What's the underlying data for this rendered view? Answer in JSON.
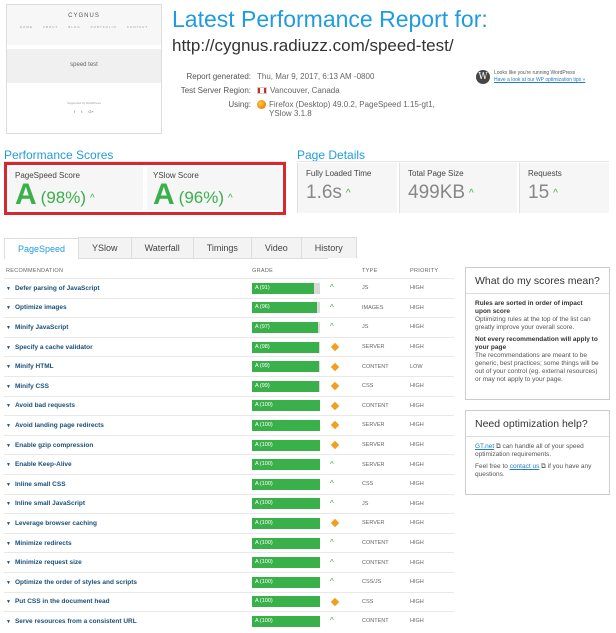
{
  "thumbnail": {
    "site_name": "CYGNUS",
    "nav": [
      "HOME",
      "ABOUT",
      "BLOG",
      "PORTFOLIO",
      "CONTACT"
    ],
    "hero_text": "speed test",
    "footer_text": "Supported by WordPress",
    "social": [
      "f",
      "t",
      "G+"
    ]
  },
  "header": {
    "title": "Latest Performance Report for:",
    "url": "http://cygnus.radiuzz.com/speed-test/"
  },
  "meta": {
    "generated_label": "Report generated:",
    "generated_value": "Thu, Mar 9, 2017, 6:13 AM -0800",
    "region_label": "Test Server Region:",
    "region_value": "Vancouver, Canada",
    "using_label": "Using:",
    "using_value_1": "Firefox (Desktop) 49.0.2, PageSpeed 1.15-gt1,",
    "using_value_2": "YSlow 3.1.8"
  },
  "wordpress": {
    "line1": "Looks like you're running WordPress",
    "link": "Have a look at our WP optimization tips »"
  },
  "performance": {
    "title": "Performance Scores",
    "scores": [
      {
        "label": "PageSpeed Score",
        "grade": "A",
        "value": "(98%)"
      },
      {
        "label": "YSlow Score",
        "grade": "A",
        "value": "(96%)"
      }
    ]
  },
  "page_details": {
    "title": "Page Details",
    "items": [
      {
        "label": "Fully Loaded Time",
        "value": "1.6s"
      },
      {
        "label": "Total Page Size",
        "value": "499KB"
      },
      {
        "label": "Requests",
        "value": "15"
      }
    ]
  },
  "tabs": [
    "PageSpeed",
    "YSlow",
    "Waterfall",
    "Timings",
    "Video",
    "History"
  ],
  "table": {
    "headers": [
      "RECOMMENDATION",
      "GRADE",
      "TYPE",
      "PRIORITY"
    ],
    "rows": [
      {
        "rec": "Defer parsing of JavaScript",
        "grade": "A (91)",
        "pct": 91,
        "icon": "up",
        "type": "JS",
        "priority": "HIGH"
      },
      {
        "rec": "Optimize images",
        "grade": "A (96)",
        "pct": 96,
        "icon": "up",
        "type": "IMAGES",
        "priority": "HIGH"
      },
      {
        "rec": "Minify JavaScript",
        "grade": "A (97)",
        "pct": 97,
        "icon": "up",
        "type": "JS",
        "priority": "HIGH"
      },
      {
        "rec": "Specify a cache validator",
        "grade": "A (98)",
        "pct": 98,
        "icon": "diamond",
        "type": "SERVER",
        "priority": "HIGH"
      },
      {
        "rec": "Minify HTML",
        "grade": "A (99)",
        "pct": 99,
        "icon": "diamond",
        "type": "CONTENT",
        "priority": "LOW"
      },
      {
        "rec": "Minify CSS",
        "grade": "A (99)",
        "pct": 99,
        "icon": "diamond",
        "type": "CSS",
        "priority": "HIGH"
      },
      {
        "rec": "Avoid bad requests",
        "grade": "A (100)",
        "pct": 100,
        "icon": "diamond",
        "type": "CONTENT",
        "priority": "HIGH"
      },
      {
        "rec": "Avoid landing page redirects",
        "grade": "A (100)",
        "pct": 100,
        "icon": "diamond",
        "type": "SERVER",
        "priority": "HIGH"
      },
      {
        "rec": "Enable gzip compression",
        "grade": "A (100)",
        "pct": 100,
        "icon": "diamond",
        "type": "SERVER",
        "priority": "HIGH"
      },
      {
        "rec": "Enable Keep-Alive",
        "grade": "A (100)",
        "pct": 100,
        "icon": "up",
        "type": "SERVER",
        "priority": "HIGH"
      },
      {
        "rec": "Inline small CSS",
        "grade": "A (100)",
        "pct": 100,
        "icon": "up",
        "type": "CSS",
        "priority": "HIGH"
      },
      {
        "rec": "Inline small JavaScript",
        "grade": "A (100)",
        "pct": 100,
        "icon": "up",
        "type": "JS",
        "priority": "HIGH"
      },
      {
        "rec": "Leverage browser caching",
        "grade": "A (100)",
        "pct": 100,
        "icon": "diamond",
        "type": "SERVER",
        "priority": "HIGH"
      },
      {
        "rec": "Minimize redirects",
        "grade": "A (100)",
        "pct": 100,
        "icon": "up",
        "type": "CONTENT",
        "priority": "HIGH"
      },
      {
        "rec": "Minimize request size",
        "grade": "A (100)",
        "pct": 100,
        "icon": "up",
        "type": "CONTENT",
        "priority": "HIGH"
      },
      {
        "rec": "Optimize the order of styles and scripts",
        "grade": "A (100)",
        "pct": 100,
        "icon": "up",
        "type": "CSS/JS",
        "priority": "HIGH"
      },
      {
        "rec": "Put CSS in the document head",
        "grade": "A (100)",
        "pct": 100,
        "icon": "diamond",
        "type": "CSS",
        "priority": "HIGH"
      },
      {
        "rec": "Serve resources from a consistent URL",
        "grade": "A (100)",
        "pct": 100,
        "icon": "up",
        "type": "CONTENT",
        "priority": "HIGH"
      }
    ]
  },
  "sidebar": {
    "box1_title": "What do my scores mean?",
    "box1_b1": "Rules are sorted in order of impact upon score",
    "box1_p1": "Optimizing rules at the top of the list can greatly improve your overall score.",
    "box1_b2": "Not every recommendation will apply to your page",
    "box1_p2": "The recommendations are meant to be generic, best practices; some things will be out of your control (eg. external resources) or may not apply to your page.",
    "box2_title": "Need optimization help?",
    "box2_link1": "GT.net",
    "box2_p1": "can handle all of your speed optimization requirements.",
    "box2_p2a": "Feel free to",
    "box2_link2": "contact us",
    "box2_p2b": "if you have any questions."
  },
  "colors": {
    "accent": "#1f9ce0",
    "grade_green": "#3ab04a",
    "highlight_red": "#d9282d",
    "diamond_orange": "#f0a020"
  }
}
